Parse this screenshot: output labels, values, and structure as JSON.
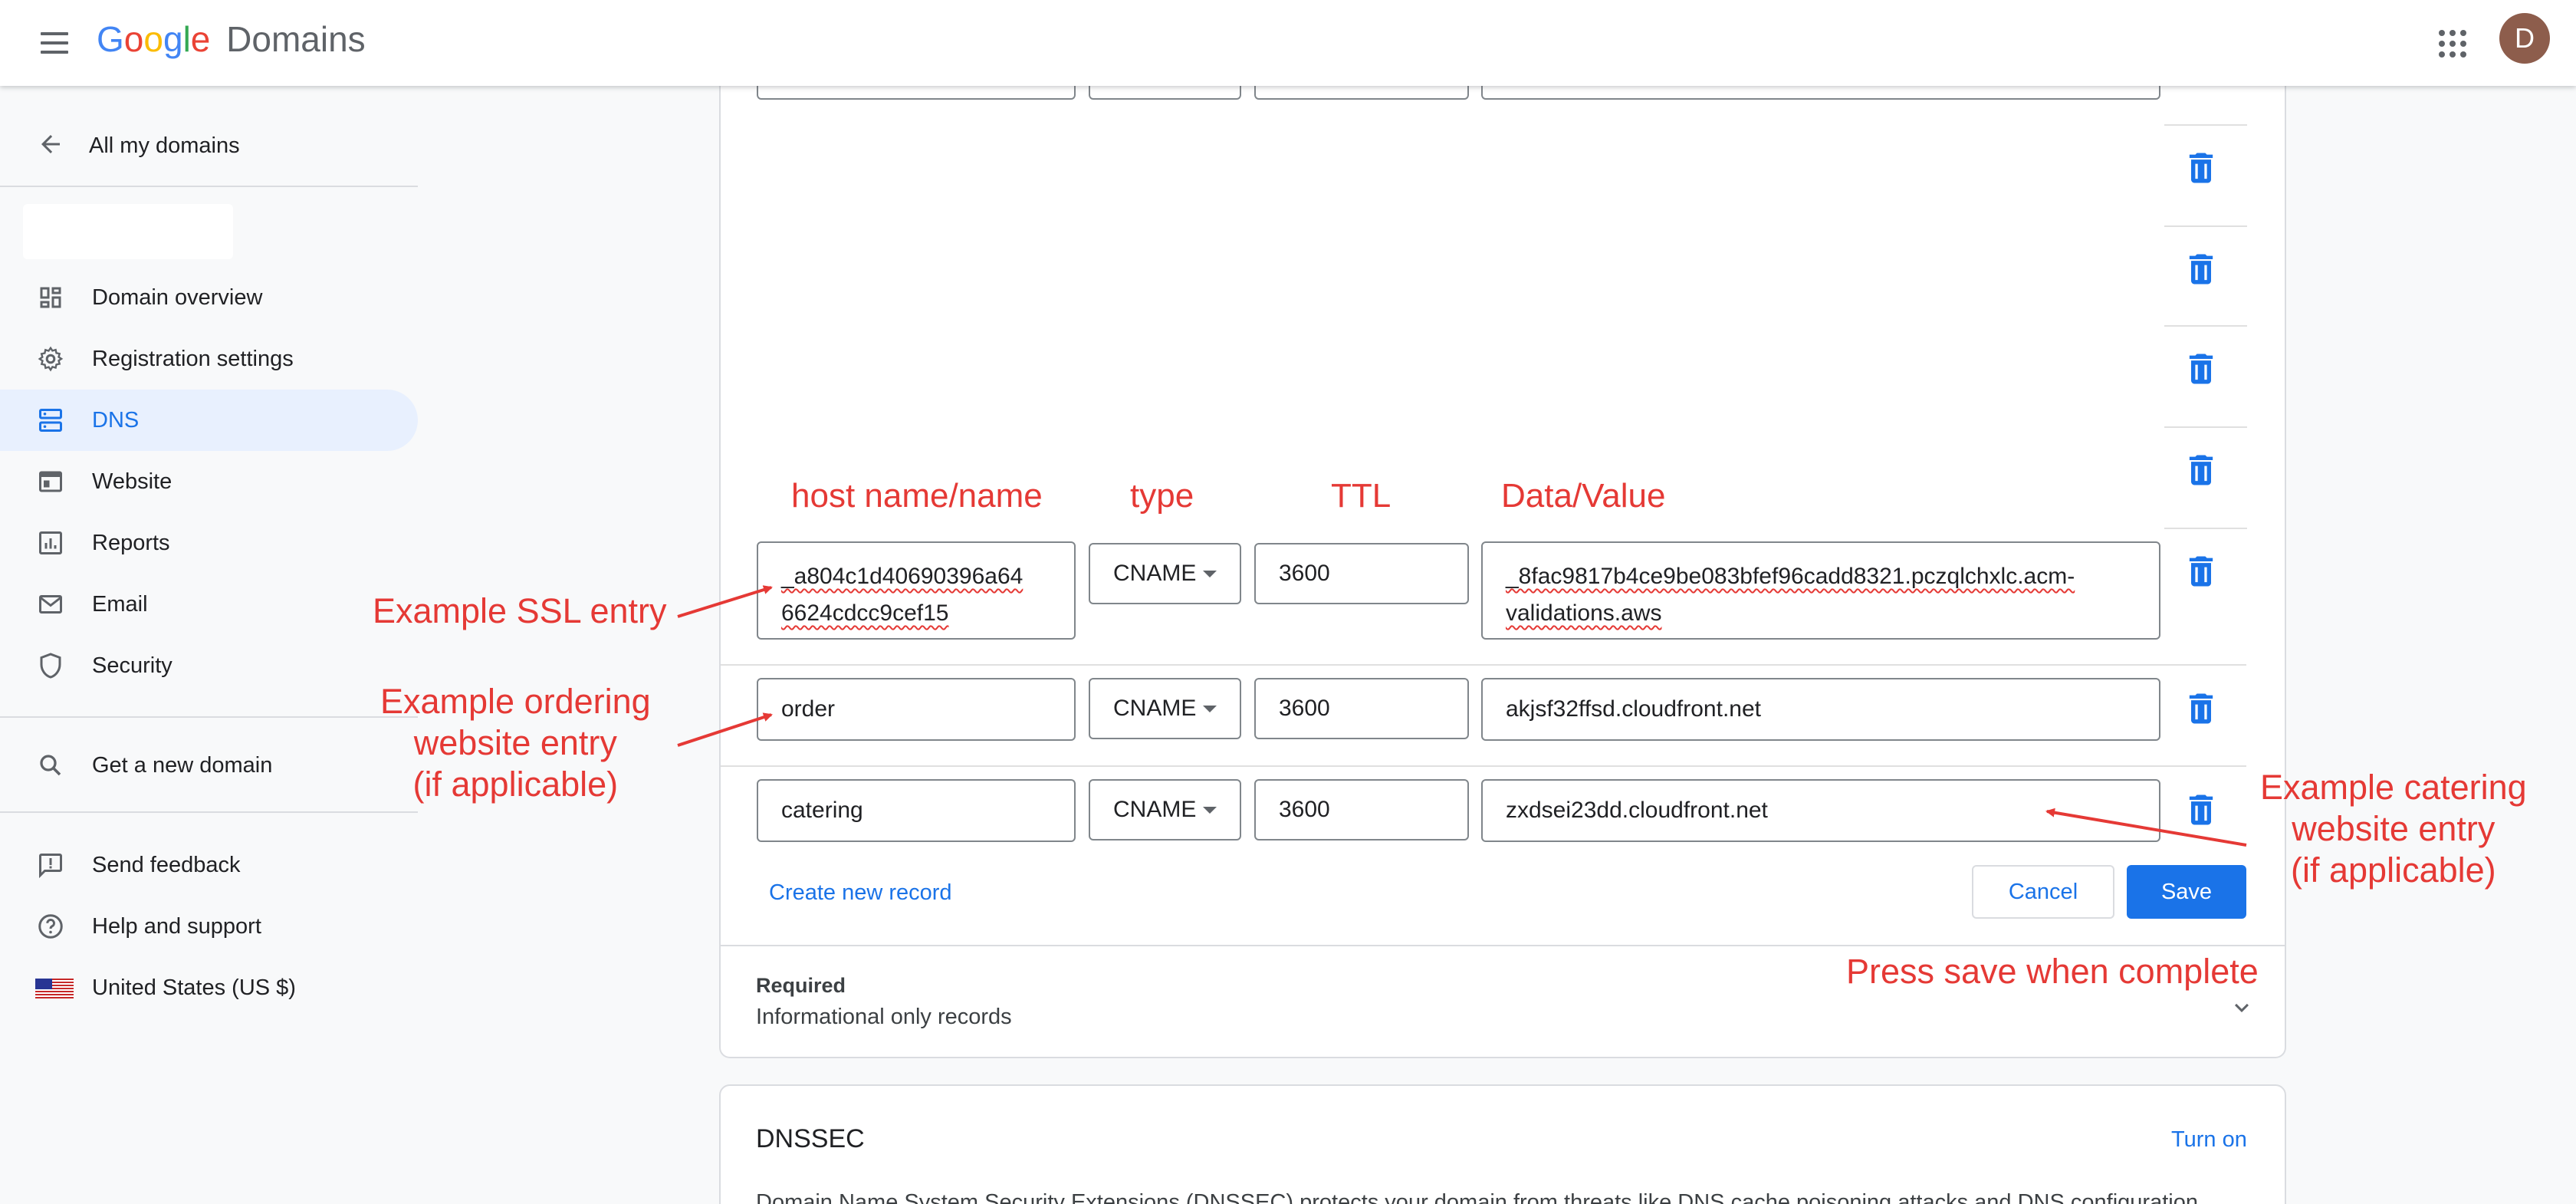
{
  "header": {
    "logo_google": [
      "G",
      "o",
      "o",
      "g",
      "l",
      "e"
    ],
    "logo_colors": [
      "#4285f4",
      "#ea4335",
      "#fbbc05",
      "#4285f4",
      "#34a853",
      "#ea4335"
    ],
    "product": "Domains",
    "avatar_initial": "D",
    "icons": [
      "menu-icon",
      "apps-icon"
    ]
  },
  "sidebar": {
    "back_label": "All my domains",
    "nav": [
      {
        "label": "Domain overview",
        "icon": "dashboard-icon",
        "active": false
      },
      {
        "label": "Registration settings",
        "icon": "gear-icon",
        "active": false
      },
      {
        "label": "DNS",
        "icon": "dns-icon",
        "active": true
      },
      {
        "label": "Website",
        "icon": "website-icon",
        "active": false
      },
      {
        "label": "Reports",
        "icon": "reports-icon",
        "active": false
      },
      {
        "label": "Email",
        "icon": "email-icon",
        "active": false
      },
      {
        "label": "Security",
        "icon": "shield-icon",
        "active": false
      }
    ],
    "get_domain": "Get a new domain",
    "footer": [
      {
        "label": "Send feedback",
        "icon": "feedback-icon"
      },
      {
        "label": "Help and support",
        "icon": "help-icon"
      },
      {
        "label": "United States (US $)",
        "icon": "us-flag-icon"
      }
    ]
  },
  "records": {
    "column_annotations": {
      "host": "host name/name",
      "type": "type",
      "ttl": "TTL",
      "data": "Data/Value"
    },
    "rows": [
      {
        "host": "_a804c1d40690396a64",
        "host_line2": "6624cdcc9cef15",
        "type": "CNAME",
        "ttl": "3600",
        "data": "_8fac9817b4ce9be083bfef96cadd8321.pczqlchxlc.acm-",
        "data_line2": "validations.aws"
      },
      {
        "host": "order",
        "type": "CNAME",
        "ttl": "3600",
        "data": "akjsf32ffsd.cloudfront.net"
      },
      {
        "host": "catering",
        "type": "CNAME",
        "ttl": "3600",
        "data": "zxdsei23dd.cloudfront.net"
      }
    ],
    "create_new": "Create new record",
    "cancel": "Cancel",
    "save": "Save",
    "required_title": "Required",
    "required_sub": "Informational only records"
  },
  "annotations": {
    "ssl": "Example SSL entry",
    "ordering": [
      "Example ordering",
      "website entry",
      "(if applicable)"
    ],
    "catering": [
      "Example catering",
      "website entry",
      "(if applicable)"
    ],
    "save": "Press save when complete",
    "color": "#e53935"
  },
  "dnssec": {
    "title": "DNSSEC",
    "turn_on": "Turn on",
    "body": "Domain Name System Security Extensions (DNSSEC) protects your domain from threats like DNS cache poisoning attacks and DNS configuration"
  },
  "colors": {
    "accent": "#1a73e8",
    "active_bg": "#e8f0fe",
    "annotation": "#e53935",
    "trash": "#1a73e8"
  }
}
